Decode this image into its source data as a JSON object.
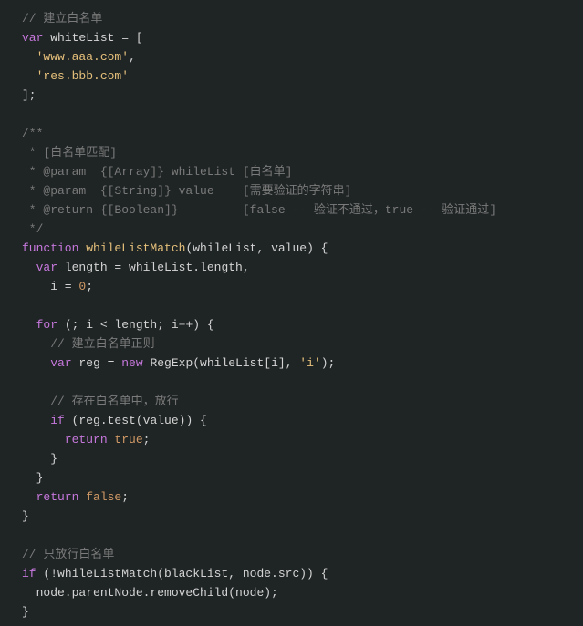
{
  "code": {
    "l1": "// 建立白名单",
    "l2_var": "var",
    "l2_name": " whiteList ",
    "l2_eq": "= [",
    "l3_str": "'www.aaa.com'",
    "l3_comma": ",",
    "l4_str": "'res.bbb.com'",
    "l5": "];",
    "l6_open": "/**",
    "l7": " * [白名单匹配]",
    "l8": " * @param  {[Array]} whileList [白名单]",
    "l9": " * @param  {[String]} value    [需要验证的字符串]",
    "l10": " * @return {[Boolean]}         [false -- 验证不通过，true -- 验证通过]",
    "l11": " */",
    "l12_fn": "function",
    "l12_name": " whileListMatch",
    "l12_params": "(whileList, value) {",
    "l13_var": "var",
    "l13_rest": " length = whileList.length,",
    "l14_i": "    i = ",
    "l14_zero": "0",
    "l14_semi": ";",
    "l15_for": "for",
    "l15_rest": " (; i < length; i++) {",
    "l16": "// 建立白名单正则",
    "l17_var": "var",
    "l17_reg": " reg = ",
    "l17_new": "new",
    "l17_regexp": " RegExp",
    "l17_args1": "(whileList[i], ",
    "l17_str": "'i'",
    "l17_args2": ");",
    "l18": "// 存在白名单中，放行",
    "l19_if": "if",
    "l19_rest": " (reg.test(value)) {",
    "l20_ret": "return",
    "l20_true": " true",
    "l20_semi": ";",
    "l21": "}",
    "l22": "}",
    "l23_ret": "return",
    "l23_false": " false",
    "l23_semi": ";",
    "l24": "}",
    "l25": "// 只放行白名单",
    "l26_if": "if",
    "l26_rest": " (!whileListMatch(blackList, node.src)) {",
    "l27": "  node.parentNode.removeChild(node);",
    "l28": "}"
  }
}
